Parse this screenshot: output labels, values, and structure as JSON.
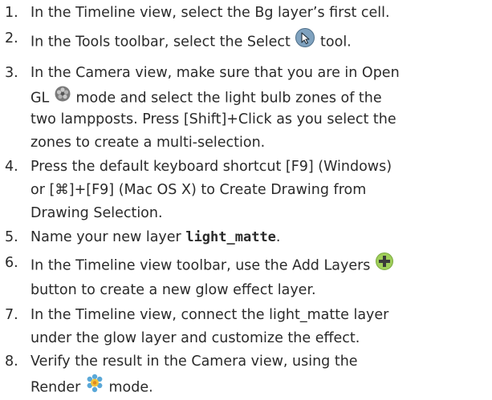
{
  "steps": [
    {
      "number": "1.",
      "lines": [
        "In the Timeline view, select the Bg layer’s first cell."
      ]
    },
    {
      "number": "2.",
      "before": "In the Tools toolbar, select the Select",
      "icon": "select-arrow-icon",
      "after": "tool."
    },
    {
      "number": "3.",
      "lines": [
        "In the Camera view, make sure that you are in Open",
        "mode and select the light bulb zones of the",
        "two lampposts. Press [Shift]+Click as you select the",
        "zones to create a multi-selection."
      ],
      "line2_prefix": "GL",
      "icon": "opengl-mode-icon"
    },
    {
      "number": "4.",
      "lines": [
        "Press the default keyboard shortcut [F9] (Windows)",
        "or [⌘]+[F9] (Mac OS X) to Create Drawing from",
        "Drawing Selection."
      ]
    },
    {
      "number": "5.",
      "before": "Name your new layer",
      "code": "light_matte",
      "after": "."
    },
    {
      "number": "6.",
      "lines": [
        "In the Timeline view toolbar, use the Add Layers",
        "button to create a new glow effect layer."
      ],
      "icon": "add-layers-icon"
    },
    {
      "number": "7.",
      "lines": [
        "In the Timeline view, connect the light_matte layer",
        "under the glow layer and customize the effect."
      ]
    },
    {
      "number": "8.",
      "lines": [
        "Verify the result in the Camera view, using the",
        "mode."
      ],
      "line2_prefix": "Render",
      "icon": "render-mode-icon"
    }
  ],
  "colors": {
    "text": "#2a2a2a",
    "add_icon_fill": "#9fce5a",
    "select_icon_fill": "#7fa2bf",
    "render_icon_fill": "#5aa8d8",
    "opengl_icon_fill": "#7a7a7a"
  }
}
